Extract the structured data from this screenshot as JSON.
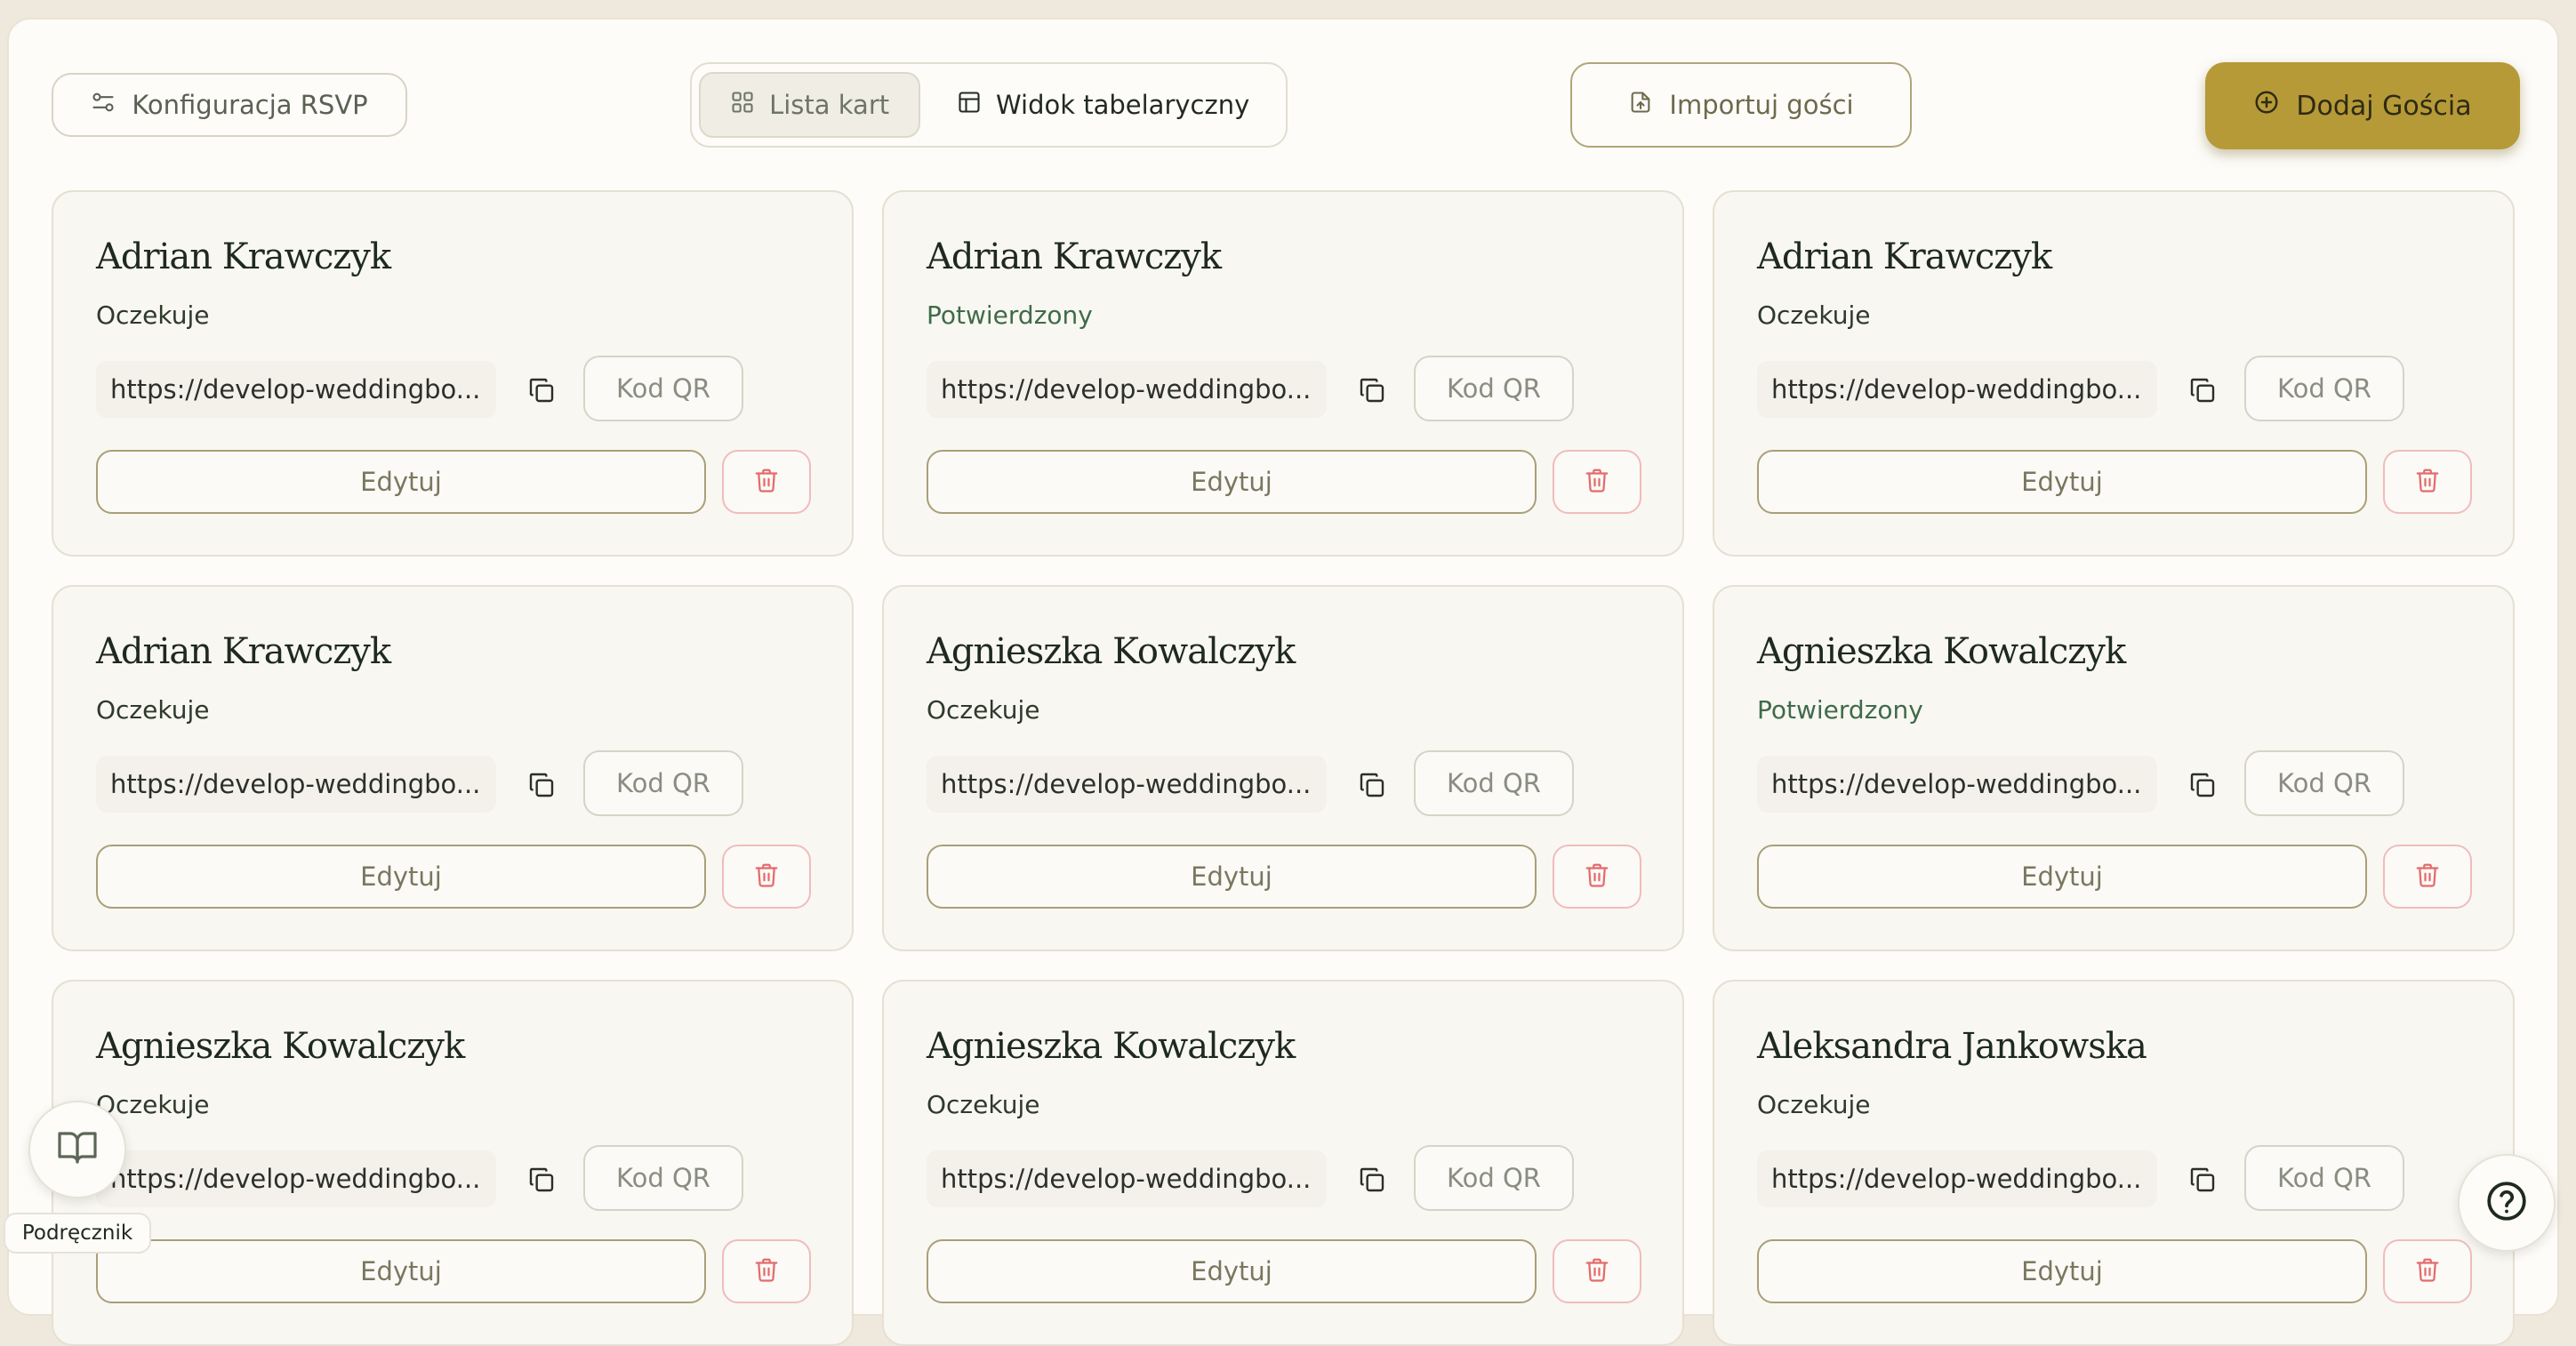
{
  "toolbar": {
    "rsvp_config_label": "Konfiguracja RSVP",
    "view_cards_label": "Lista kart",
    "view_table_label": "Widok tabelaryczny",
    "import_label": "Importuj gości",
    "add_guest_label": "Dodaj Gościa"
  },
  "guests": [
    {
      "name": "Adrian Krawczyk",
      "status": "Oczekuje",
      "link": "https://develop-weddingbo...",
      "qr_label": "Kod QR",
      "edit_label": "Edytuj"
    },
    {
      "name": "Adrian Krawczyk",
      "status": "Potwierdzony",
      "link": "https://develop-weddingbo...",
      "qr_label": "Kod QR",
      "edit_label": "Edytuj"
    },
    {
      "name": "Adrian Krawczyk",
      "status": "Oczekuje",
      "link": "https://develop-weddingbo...",
      "qr_label": "Kod QR",
      "edit_label": "Edytuj"
    },
    {
      "name": "Adrian Krawczyk",
      "status": "Oczekuje",
      "link": "https://develop-weddingbo...",
      "qr_label": "Kod QR",
      "edit_label": "Edytuj"
    },
    {
      "name": "Agnieszka Kowalczyk",
      "status": "Oczekuje",
      "link": "https://develop-weddingbo...",
      "qr_label": "Kod QR",
      "edit_label": "Edytuj"
    },
    {
      "name": "Agnieszka Kowalczyk",
      "status": "Potwierdzony",
      "link": "https://develop-weddingbo...",
      "qr_label": "Kod QR",
      "edit_label": "Edytuj"
    },
    {
      "name": "Agnieszka Kowalczyk",
      "status": "Oczekuje",
      "link": "https://develop-weddingbo...",
      "qr_label": "Kod QR",
      "edit_label": "Edytuj"
    },
    {
      "name": "Agnieszka Kowalczyk",
      "status": "Oczekuje",
      "link": "https://develop-weddingbo...",
      "qr_label": "Kod QR",
      "edit_label": "Edytuj"
    },
    {
      "name": "Aleksandra Jankowska",
      "status": "Oczekuje",
      "link": "https://develop-weddingbo...",
      "qr_label": "Kod QR",
      "edit_label": "Edytuj"
    }
  ],
  "manual": {
    "label": "Podręcznik"
  },
  "colors": {
    "accent": "#b59a37",
    "confirmed": "#3f6b4a",
    "danger": "#e46b6b"
  }
}
